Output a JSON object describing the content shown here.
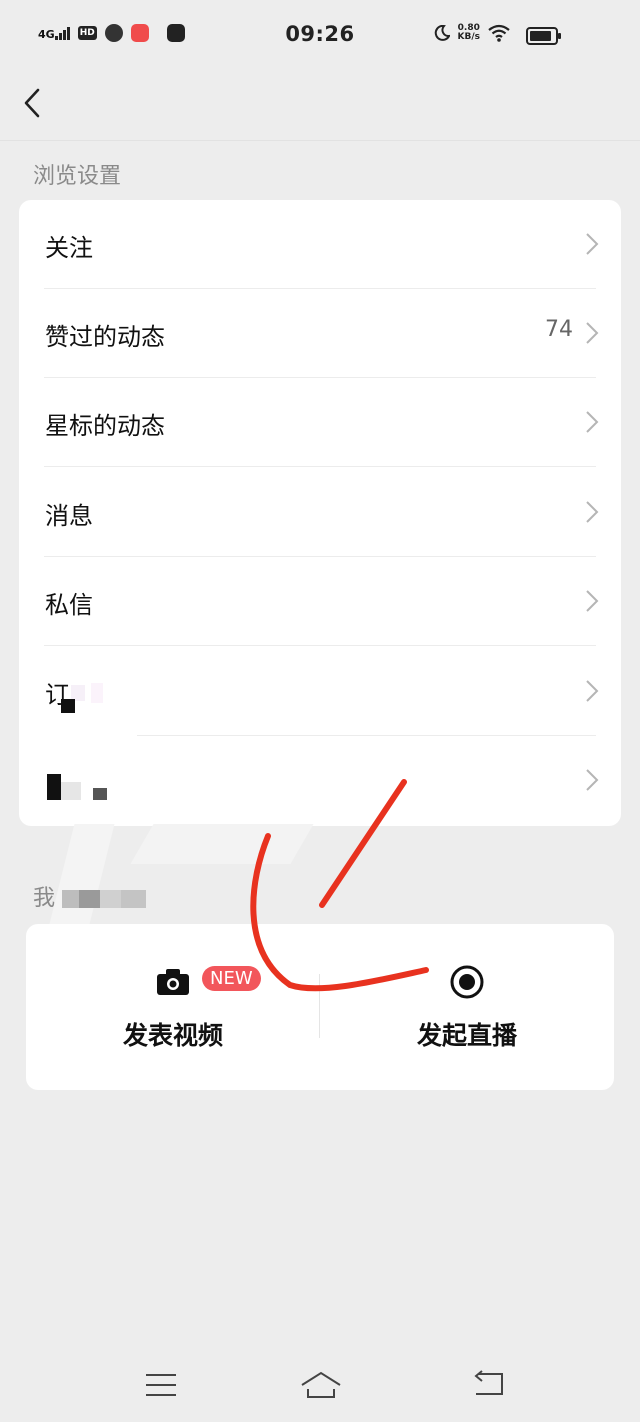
{
  "status_bar": {
    "network": "4G",
    "hd": "HD",
    "time": "09:26",
    "speed_value": "0.80",
    "speed_unit": "KB/s"
  },
  "header": {
    "back_icon": "chevron-left-icon"
  },
  "browse_section": {
    "title": "浏览设置",
    "items": [
      {
        "label": "关注",
        "count": ""
      },
      {
        "label": "赞过的动态",
        "count": "74"
      },
      {
        "label": "星标的动态",
        "count": ""
      },
      {
        "label": "消息",
        "count": ""
      },
      {
        "label": "私信",
        "count": ""
      },
      {
        "label": "订",
        "count": ""
      },
      {
        "label": "",
        "count": ""
      }
    ]
  },
  "video_section": {
    "title": "我",
    "publish_video": "发表视频",
    "new_badge": "NEW",
    "start_live": "发起直播"
  },
  "colors": {
    "background": "#ededed",
    "card": "#ffffff",
    "badge": "#f2565b",
    "annotation_stroke": "#e8321f"
  }
}
